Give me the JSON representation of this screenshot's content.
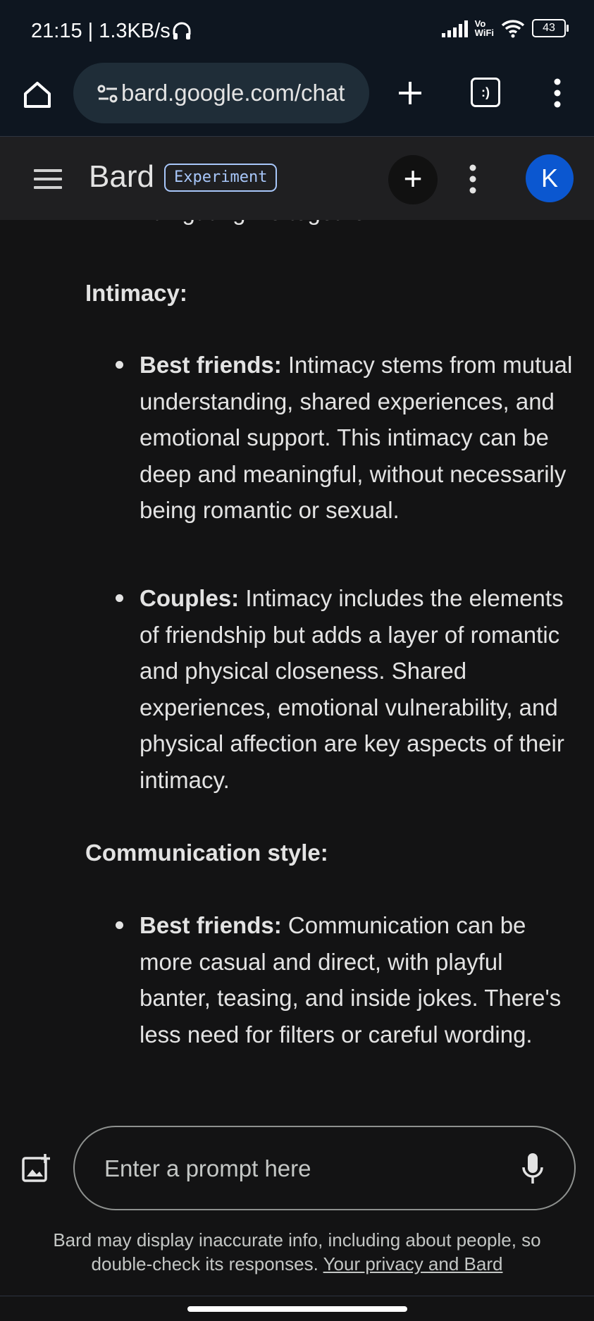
{
  "status_bar": {
    "time_speed": "21:15 | 1.3KB/s",
    "headset_icon": "headset-icon",
    "vo_label": "Vo",
    "wifi_label": "WiFi",
    "battery": "43"
  },
  "browser": {
    "url": "bard.google.com/chat",
    "tab_count_glyph": ":)",
    "icons": [
      "home-icon",
      "site-settings-icon",
      "plus-icon",
      "tabs-icon",
      "more-vert-icon"
    ]
  },
  "app_bar": {
    "title": "Bard",
    "badge": "Experiment",
    "new_chat": "+",
    "avatar_letter": "K",
    "accent": "#0b57d0"
  },
  "response": {
    "partial_line": "navigating life together.",
    "sections": [
      {
        "heading": "Intimacy:",
        "items": [
          {
            "term": "Best friends:",
            "text": "Intimacy stems from mutual understanding, shared experiences, and emotional support. This intimacy can be deep and meaningful, without necessarily being romantic or sexual."
          },
          {
            "term": "Couples:",
            "text": "Intimacy includes the elements of friendship but adds a layer of romantic and physical closeness. Shared experiences, emotional vulnerability, and physical affection are key aspects of their intimacy."
          }
        ]
      },
      {
        "heading": "Communication style:",
        "items": [
          {
            "term": "Best friends:",
            "text": "Communication can be more casual and direct, with playful banter, teasing, and inside jokes. There's less need for filters or careful wording."
          }
        ]
      }
    ]
  },
  "prompt": {
    "placeholder": "Enter a prompt here"
  },
  "disclaimer": {
    "text": "Bard may display inaccurate info, including about people, so double-check its responses.",
    "link": "Your privacy and Bard"
  }
}
